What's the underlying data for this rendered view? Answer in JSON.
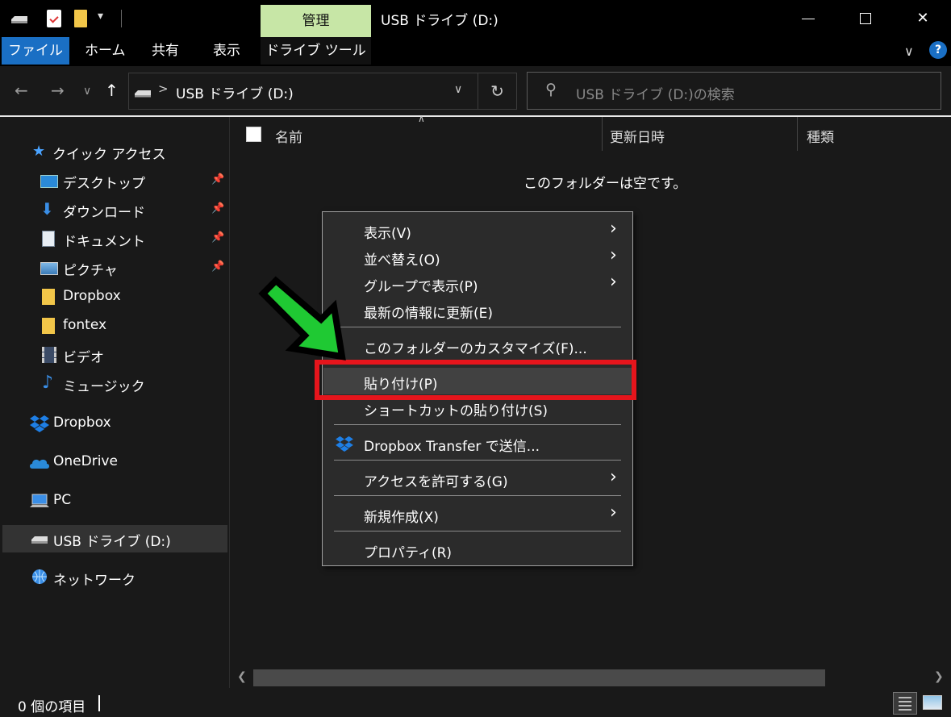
{
  "window": {
    "title": "USB ドライブ (D:)",
    "contextual_tab_group": "管理"
  },
  "ribbon": {
    "tabs": [
      "ファイル",
      "ホーム",
      "共有",
      "表示",
      "ドライブ ツール"
    ]
  },
  "address_bar": {
    "path": "USB ドライブ (D:)",
    "separator": ">"
  },
  "search": {
    "placeholder": "USB ドライブ (D:)の検索"
  },
  "sidebar": {
    "quick_access": "クイック アクセス",
    "items": [
      {
        "label": "デスクトップ",
        "pinned": true
      },
      {
        "label": "ダウンロード",
        "pinned": true
      },
      {
        "label": "ドキュメント",
        "pinned": true
      },
      {
        "label": "ピクチャ",
        "pinned": true
      },
      {
        "label": "Dropbox",
        "pinned": false
      },
      {
        "label": "fontex",
        "pinned": false
      },
      {
        "label": "ビデオ",
        "pinned": false
      },
      {
        "label": "ミュージック",
        "pinned": false
      }
    ],
    "roots": [
      {
        "label": "Dropbox"
      },
      {
        "label": "OneDrive"
      },
      {
        "label": "PC"
      },
      {
        "label": "USB ドライブ (D:)",
        "selected": true
      },
      {
        "label": "ネットワーク"
      }
    ]
  },
  "file_list": {
    "columns": [
      "名前",
      "更新日時",
      "種類"
    ],
    "empty_message": "このフォルダーは空です。"
  },
  "status_bar": {
    "item_count": "0 個の項目"
  },
  "context_menu": {
    "items": [
      {
        "label": "表示(V)",
        "submenu": true
      },
      {
        "label": "並べ替え(O)",
        "submenu": true
      },
      {
        "label": "グループで表示(P)",
        "submenu": true
      },
      {
        "label": "最新の情報に更新(E)",
        "submenu": false
      },
      {
        "label": "このフォルダーのカスタマイズ(F)...",
        "submenu": false
      },
      {
        "label": "貼り付け(P)",
        "submenu": false,
        "highlighted": true
      },
      {
        "label": "ショートカットの貼り付け(S)",
        "submenu": false
      },
      {
        "label": "Dropbox Transfer で送信...",
        "submenu": false,
        "icon": "dropbox-icon"
      },
      {
        "label": "アクセスを許可する(G)",
        "submenu": true
      },
      {
        "label": "新規作成(X)",
        "submenu": true
      },
      {
        "label": "プロパティ(R)",
        "submenu": false
      }
    ]
  },
  "colors": {
    "accent": "#1a6fc4",
    "manage_tab": "#c7e6a6",
    "highlight_box": "#e6151c",
    "arrow": "#1fc933"
  }
}
